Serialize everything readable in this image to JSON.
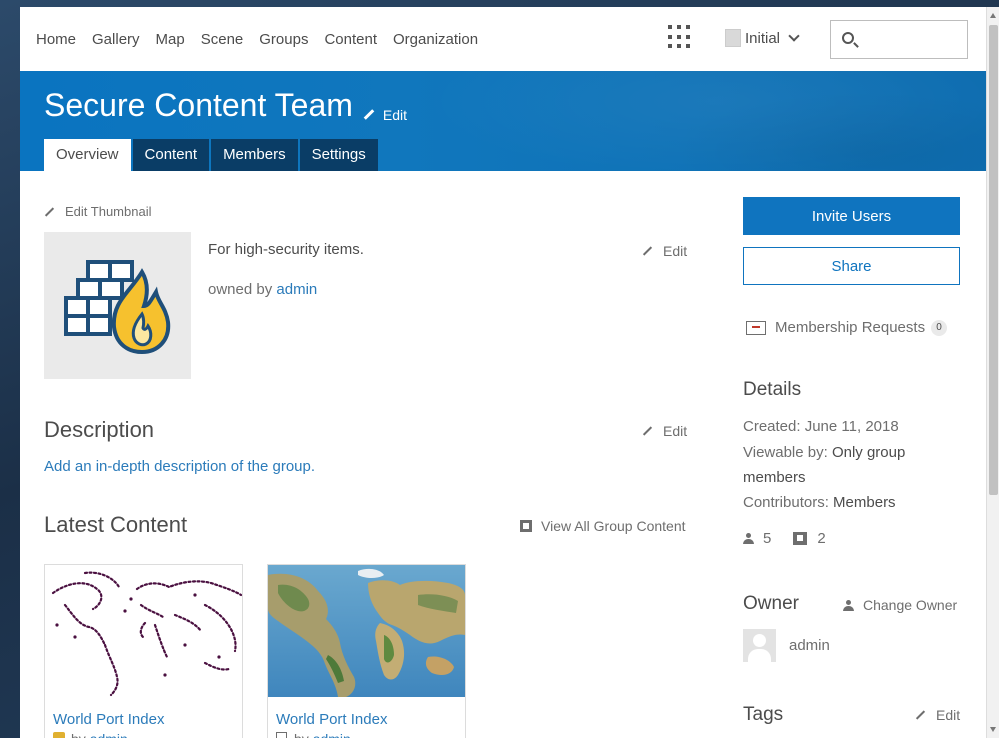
{
  "nav": {
    "links": [
      "Home",
      "Gallery",
      "Map",
      "Scene",
      "Groups",
      "Content",
      "Organization"
    ],
    "user_label": "Initial",
    "search_placeholder": ""
  },
  "header": {
    "title": "Secure Content Team",
    "edit_label": "Edit",
    "tabs": [
      "Overview",
      "Content",
      "Members",
      "Settings"
    ],
    "active_tab": "Overview"
  },
  "overview": {
    "edit_thumbnail_label": "Edit Thumbnail",
    "summary": "For high-security items.",
    "owned_by_prefix": "owned by",
    "owner": "admin",
    "edit_label": "Edit"
  },
  "description": {
    "heading": "Description",
    "edit_label": "Edit",
    "placeholder_link": "Add an in-depth description of the group."
  },
  "latest_content": {
    "heading": "Latest Content",
    "view_all_label": "View All Group Content",
    "items": [
      {
        "title": "World Port Index",
        "by_prefix": "by",
        "owner": "admin"
      },
      {
        "title": "World Port Index",
        "by_prefix": "by",
        "owner": "admin"
      }
    ]
  },
  "sidebar": {
    "invite_label": "Invite Users",
    "share_label": "Share",
    "membership_requests_label": "Membership Requests",
    "membership_requests_count": "0",
    "details_heading": "Details",
    "created_label": "Created:",
    "created_value": "June 11, 2018",
    "viewable_label": "Viewable by:",
    "viewable_value_1": "Only group",
    "viewable_value_2": "members",
    "contributors_label": "Contributors:",
    "contributors_value": "Members",
    "member_count": "5",
    "item_count": "2",
    "owner_heading": "Owner",
    "change_owner_label": "Change Owner",
    "owner_name": "admin",
    "tags_heading": "Tags",
    "tags_edit_label": "Edit"
  },
  "colors": {
    "banner": "#0a74c0",
    "tab_dark": "#0a3d66",
    "link": "#2b7bba",
    "button_primary": "#0f74bf"
  }
}
